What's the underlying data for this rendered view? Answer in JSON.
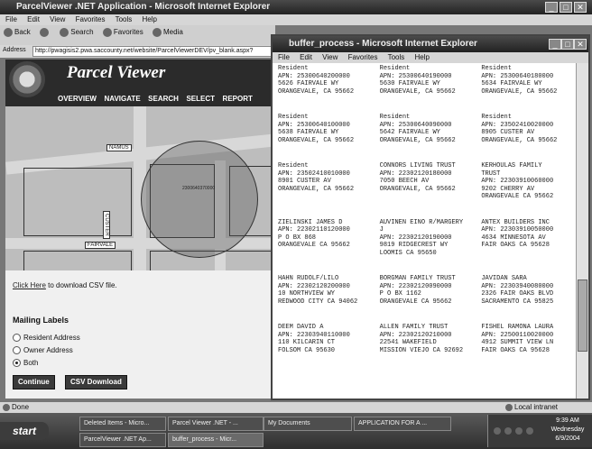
{
  "main_window": {
    "title": "ParcelViewer .NET Application - Microsoft Internet Explorer",
    "menu": [
      "File",
      "Edit",
      "View",
      "Favorites",
      "Tools",
      "Help"
    ],
    "toolbar": {
      "back": "Back",
      "search": "Search",
      "favorites": "Favorites",
      "media": "Media"
    },
    "address_label": "Address",
    "url": "http://pwagisis2.pwa.saccounty.net/website/ParcelViewerDEV/pv_blank.aspx?",
    "app_name": "Parcel Viewer",
    "nav": [
      "OVERVIEW",
      "NAVIGATE",
      "SEARCH",
      "SELECT",
      "REPORT"
    ],
    "map": {
      "street_labels": [
        "NAMUS",
        "FAIRVALE",
        "CUSTER"
      ],
      "parcel_label": "2300640370000"
    },
    "csv_link": "Click Here",
    "csv_text": " to download CSV file.",
    "mailing_labels_heading": "Mailing Labels",
    "options": [
      {
        "label": "Resident Address",
        "selected": false
      },
      {
        "label": "Owner Address",
        "selected": false
      },
      {
        "label": "Both",
        "selected": true
      }
    ],
    "continue_label": "Continue",
    "csv_download_label": "CSV Download",
    "status": "Done"
  },
  "popup": {
    "title": "buffer_process - Microsoft Internet Explorer",
    "menu": [
      "File",
      "Edit",
      "View",
      "Favorites",
      "Tools",
      "Help"
    ],
    "labels": [
      [
        "Resident",
        "APN: 25300640200000",
        "5626 FAIRVALE WY",
        "ORANGEVALE, CA 95662"
      ],
      [
        "Resident",
        "APN: 25300640190000",
        "5630 FAIRVALE WY",
        "ORANGEVALE, CA 95662"
      ],
      [
        "Resident",
        "APN: 25300640180000",
        "5634 FAIRVALE WY",
        "ORANGEVALE, CA 95662"
      ],
      [
        "Resident",
        "APN: 25300640100000",
        "5638 FAIRVALE WY",
        "ORANGEVALE, CA 95662"
      ],
      [
        "Resident",
        "APN: 25300640090000",
        "5642 FAIRVALE WY",
        "ORANGEVALE, CA 95662"
      ],
      [
        "Resident",
        "APN: 23502410020000",
        "8905 CUSTER AV",
        "ORANGEVALE, CA 95662"
      ],
      [
        "Resident",
        "APN: 23502410010000",
        "8901 CUSTER AV",
        "ORANGEVALE, CA 95662"
      ],
      [
        "CONNORS LIVING TRUST",
        "APN: 22302120180000",
        "7050 BEECH AV",
        "ORANGEVALE, CA 95662"
      ],
      [
        "KERHOULAS FAMILY",
        "TRUST",
        "APN: 22303910060000",
        "9202 CHERRY AV",
        "ORANGEVALE CA 95662"
      ],
      [
        "ZIELINSKI JAMES D",
        "APN: 22302110120000",
        "P O BX 868",
        "ORANGEVALE CA 95662"
      ],
      [
        "AUVINEN EINO R/MARGERY",
        "J",
        "APN: 22302120190000",
        "9819 RIDGECREST WY",
        "LOOMIS CA 95650"
      ],
      [
        "ANTEX BUILDERS INC",
        "APN: 22303910050000",
        "4634 MINNESOTA AV",
        "FAIR OAKS CA 95628"
      ],
      [
        "HAHN RUDOLF/LILO",
        "APN: 22302120200000",
        "10 NORTHVIEW WY",
        "REDWOOD CITY CA 94062"
      ],
      [
        "BORGMAN FAMILY TRUST",
        "APN: 22302120090000",
        "P O BX 1162",
        "ORANGEVALE CA 95662"
      ],
      [
        "JAVIDAN SARA",
        "APN: 22303940080000",
        "2326 FAIR OAKS BLVD",
        "SACRAMENTO CA 95825"
      ],
      [
        "DEEM DAVID A",
        "APN: 22303940110000",
        "110 KILCARIN CT",
        "FOLSOM CA 95630"
      ],
      [
        "ALLEN FAMILY TRUST",
        "APN: 22302120210000",
        "22541 WAKEFIELD",
        "MISSION VIEJO CA 92692"
      ],
      [
        "FISHEL RAMONA LAURA",
        "APN: 22500110020000",
        "4912 SUMMIT VIEW LN",
        "FAIR OAKS CA 95628"
      ]
    ],
    "zone": "Local intranet"
  },
  "taskbar": {
    "start": "start",
    "row1": [
      "Deleted Items - Micro...",
      "Parcel Viewer .NET - ...",
      "My Documents",
      "APPLICATION FOR A ..."
    ],
    "row2": [
      "ParcelViewer .NET Ap...",
      "buffer_process - Micr..."
    ],
    "clock": "9:39 AM",
    "day": "Wednesday",
    "date": "6/9/2004"
  }
}
